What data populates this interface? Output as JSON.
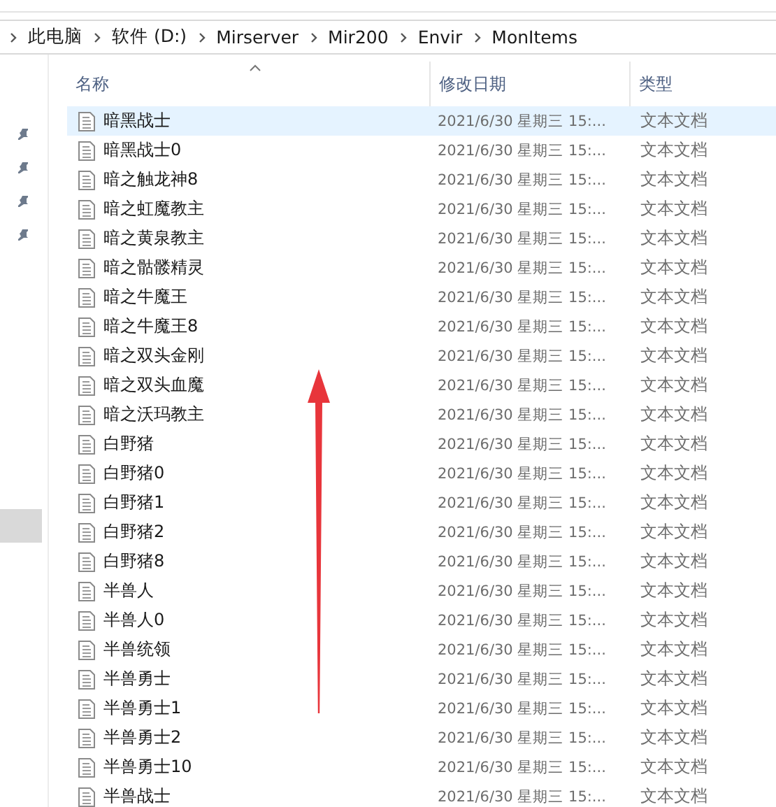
{
  "breadcrumb": [
    "此电脑",
    "软件 (D:)",
    "Mirserver",
    "Mir200",
    "Envir",
    "MonItems"
  ],
  "columns": [
    {
      "label": "名称",
      "sorted": true
    },
    {
      "label": "修改日期",
      "sorted": false
    },
    {
      "label": "类型",
      "sorted": false
    }
  ],
  "rows": [
    {
      "name": "暗黑战士",
      "date": "2021/6/30 星期三 15:...",
      "type": "文本文档",
      "selected": true
    },
    {
      "name": "暗黑战士0",
      "date": "2021/6/30 星期三 15:...",
      "type": "文本文档",
      "selected": false
    },
    {
      "name": "暗之触龙神8",
      "date": "2021/6/30 星期三 15:...",
      "type": "文本文档",
      "selected": false
    },
    {
      "name": "暗之虹魔教主",
      "date": "2021/6/30 星期三 15:...",
      "type": "文本文档",
      "selected": false
    },
    {
      "name": "暗之黄泉教主",
      "date": "2021/6/30 星期三 15:...",
      "type": "文本文档",
      "selected": false
    },
    {
      "name": "暗之骷髅精灵",
      "date": "2021/6/30 星期三 15:...",
      "type": "文本文档",
      "selected": false
    },
    {
      "name": "暗之牛魔王",
      "date": "2021/6/30 星期三 15:...",
      "type": "文本文档",
      "selected": false
    },
    {
      "name": "暗之牛魔王8",
      "date": "2021/6/30 星期三 15:...",
      "type": "文本文档",
      "selected": false
    },
    {
      "name": "暗之双头金刚",
      "date": "2021/6/30 星期三 15:...",
      "type": "文本文档",
      "selected": false
    },
    {
      "name": "暗之双头血魔",
      "date": "2021/6/30 星期三 15:...",
      "type": "文本文档",
      "selected": false
    },
    {
      "name": "暗之沃玛教主",
      "date": "2021/6/30 星期三 15:...",
      "type": "文本文档",
      "selected": false
    },
    {
      "name": "白野猪",
      "date": "2021/6/30 星期三 15:...",
      "type": "文本文档",
      "selected": false
    },
    {
      "name": "白野猪0",
      "date": "2021/6/30 星期三 15:...",
      "type": "文本文档",
      "selected": false
    },
    {
      "name": "白野猪1",
      "date": "2021/6/30 星期三 15:...",
      "type": "文本文档",
      "selected": false
    },
    {
      "name": "白野猪2",
      "date": "2021/6/30 星期三 15:...",
      "type": "文本文档",
      "selected": false
    },
    {
      "name": "白野猪8",
      "date": "2021/6/30 星期三 15:...",
      "type": "文本文档",
      "selected": false
    },
    {
      "name": "半兽人",
      "date": "2021/6/30 星期三 15:...",
      "type": "文本文档",
      "selected": false
    },
    {
      "name": "半兽人0",
      "date": "2021/6/30 星期三 15:...",
      "type": "文本文档",
      "selected": false
    },
    {
      "name": "半兽统领",
      "date": "2021/6/30 星期三 15:...",
      "type": "文本文档",
      "selected": false
    },
    {
      "name": "半兽勇士",
      "date": "2021/6/30 星期三 15:...",
      "type": "文本文档",
      "selected": false
    },
    {
      "name": "半兽勇士1",
      "date": "2021/6/30 星期三 15:...",
      "type": "文本文档",
      "selected": false
    },
    {
      "name": "半兽勇士2",
      "date": "2021/6/30 星期三 15:...",
      "type": "文本文档",
      "selected": false
    },
    {
      "name": "半兽勇士10",
      "date": "2021/6/30 星期三 15:...",
      "type": "文本文档",
      "selected": false
    },
    {
      "name": "半兽战士",
      "date": "2021/6/30 星期三 15:...",
      "type": "文本文档",
      "selected": false
    }
  ]
}
